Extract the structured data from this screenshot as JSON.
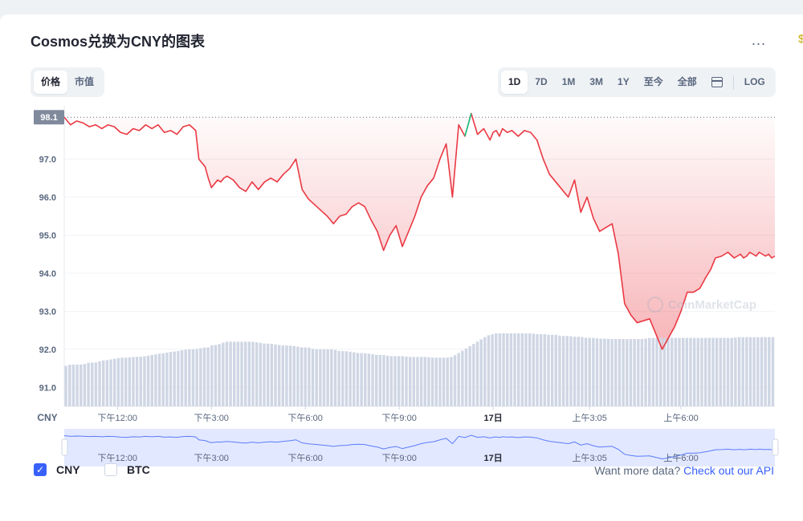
{
  "header": {
    "title": "Cosmos兑换为CNY的图表",
    "more_label": "..."
  },
  "tabs_left": [
    {
      "label": "价格",
      "active": true
    },
    {
      "label": "市值",
      "active": false
    }
  ],
  "tabs_right": [
    {
      "label": "1D",
      "active": true
    },
    {
      "label": "7D",
      "active": false
    },
    {
      "label": "1M",
      "active": false
    },
    {
      "label": "3M",
      "active": false
    },
    {
      "label": "1Y",
      "active": false
    },
    {
      "label": "至今",
      "active": false
    },
    {
      "label": "全部",
      "active": false
    }
  ],
  "log_label": "LOG",
  "calendar_icon": "calendar-icon",
  "watermark_text": "CoinMarketCap",
  "legend": [
    {
      "label": "CNY",
      "checked": true
    },
    {
      "label": "BTC",
      "checked": false
    }
  ],
  "api": {
    "prefix": "Want more data? ",
    "link": "Check out our API"
  },
  "colors": {
    "line_down": "#ea3943",
    "line_up": "#16c784",
    "volume": "#cfd6e4",
    "navigator": "#3861fb",
    "accent": "#3861fb"
  },
  "chart_data": {
    "type": "area",
    "title": "Cosmos兑换为CNY的图表",
    "ylabel": "",
    "xlabel": "",
    "currency_label": "CNY",
    "current_price_label": "98.1",
    "reference_value": 98.1,
    "ylim": [
      90.5,
      98.4
    ],
    "yticks": [
      91.0,
      92.0,
      93.0,
      94.0,
      95.0,
      96.0,
      97.0
    ],
    "ytick_labels": [
      "91.0",
      "92.0",
      "93.0",
      "94.0",
      "95.0",
      "96.0",
      "97.0"
    ],
    "xlim": [
      10.3,
      33.0
    ],
    "xticks": [
      {
        "x": 12.0,
        "label": "下午12:00"
      },
      {
        "x": 15.0,
        "label": "下午3:00"
      },
      {
        "x": 18.0,
        "label": "下午6:00"
      },
      {
        "x": 21.0,
        "label": "下午9:00"
      },
      {
        "x": 24.0,
        "label": "17日"
      },
      {
        "x": 27.08,
        "label": "上午3:05"
      },
      {
        "x": 30.0,
        "label": "上午6:00"
      }
    ],
    "series": [
      {
        "x": [
          10.3,
          10.5,
          10.7,
          10.9,
          11.1,
          11.3,
          11.5,
          11.7,
          11.9,
          12.1,
          12.3,
          12.5,
          12.7,
          12.9,
          13.1,
          13.3,
          13.5,
          13.7,
          13.9,
          14.1,
          14.3,
          14.5,
          14.6,
          14.8,
          14.9,
          15.0,
          15.2,
          15.3,
          15.4,
          15.5,
          15.7,
          15.9,
          16.1,
          16.3,
          16.5,
          16.7,
          16.9,
          17.1,
          17.3,
          17.5,
          17.7,
          17.9,
          18.1,
          18.3,
          18.5,
          18.7,
          18.9,
          19.1,
          19.3,
          19.5,
          19.7,
          19.9,
          20.1,
          20.3,
          20.5,
          20.7,
          20.9,
          21.1,
          21.3,
          21.5,
          21.7,
          21.9,
          22.1,
          22.3,
          22.5,
          22.7,
          22.9,
          23.1,
          23.3,
          23.5,
          23.7,
          23.8,
          23.9,
          24.0,
          24.1,
          24.2,
          24.3,
          24.45,
          24.6,
          24.8,
          25.0,
          25.2,
          25.4,
          25.6,
          25.8,
          26.0,
          26.2,
          26.4,
          26.6,
          26.8,
          27.0,
          27.2,
          27.4,
          27.6,
          27.8,
          28.0,
          28.2,
          28.4,
          28.6,
          28.8,
          29.0,
          29.2,
          29.4,
          29.6,
          29.8,
          30.0,
          30.2,
          30.4,
          30.6,
          30.8,
          30.95,
          31.1,
          31.3,
          31.5,
          31.7,
          31.8,
          31.9,
          32.0,
          32.1,
          32.2,
          32.3,
          32.4,
          32.5,
          32.6,
          32.7,
          32.8,
          32.9,
          33.0
        ],
        "y": [
          98.1,
          97.9,
          98.0,
          97.95,
          97.85,
          97.9,
          97.8,
          97.9,
          97.85,
          97.7,
          97.65,
          97.8,
          97.75,
          97.9,
          97.8,
          97.9,
          97.7,
          97.75,
          97.65,
          97.85,
          97.9,
          97.75,
          97.0,
          96.8,
          96.5,
          96.25,
          96.45,
          96.4,
          96.5,
          96.55,
          96.45,
          96.25,
          96.15,
          96.4,
          96.2,
          96.4,
          96.5,
          96.4,
          96.6,
          96.75,
          97.0,
          96.2,
          95.95,
          95.8,
          95.65,
          95.5,
          95.3,
          95.5,
          95.55,
          95.75,
          95.85,
          95.75,
          95.4,
          95.1,
          94.6,
          95.0,
          95.25,
          94.7,
          95.1,
          95.5,
          96.0,
          96.3,
          96.5,
          97.0,
          97.4,
          96.0,
          97.9,
          97.6,
          98.2,
          97.65,
          97.8,
          97.65,
          97.5,
          97.7,
          97.75,
          97.6,
          97.8,
          97.7,
          97.75,
          97.6,
          97.75,
          97.7,
          97.5,
          97.0,
          96.6,
          96.4,
          96.2,
          96.0,
          96.45,
          95.6,
          96.0,
          95.45,
          95.1,
          95.2,
          95.3,
          94.5,
          93.2,
          92.9,
          92.7,
          92.75,
          92.8,
          92.4,
          92.0,
          92.3,
          92.6,
          93.0,
          93.5,
          93.5,
          93.6,
          93.9,
          94.1,
          94.4,
          94.45,
          94.55,
          94.4,
          94.45,
          94.5,
          94.4,
          94.45,
          94.55,
          94.5,
          94.45,
          94.55,
          94.5,
          94.45,
          94.5,
          94.4,
          94.45
        ],
        "volume_level": [
          91.55,
          91.6,
          91.6,
          91.6,
          91.65,
          91.65,
          91.7,
          91.72,
          91.75,
          91.78,
          91.78,
          91.8,
          91.8,
          91.82,
          91.85,
          91.88,
          91.9,
          91.93,
          91.95,
          91.98,
          92.0,
          92.0,
          92.02,
          92.05,
          92.05,
          92.1,
          92.12,
          92.15,
          92.18,
          92.2,
          92.2,
          92.2,
          92.2,
          92.2,
          92.18,
          92.15,
          92.15,
          92.12,
          92.1,
          92.1,
          92.08,
          92.05,
          92.05,
          92.0,
          92.0,
          92.0,
          92.0,
          91.95,
          91.95,
          91.93,
          91.9,
          91.9,
          91.88,
          91.85,
          91.85,
          91.82,
          91.82,
          91.82,
          91.8,
          91.8,
          91.8,
          91.8,
          91.78,
          91.78,
          91.78,
          91.8,
          91.9,
          92.0,
          92.1,
          92.2,
          92.3,
          92.35,
          92.38,
          92.4,
          92.42,
          92.42,
          92.42,
          92.42,
          92.42,
          92.42,
          92.42,
          92.42,
          92.4,
          92.4,
          92.38,
          92.38,
          92.35,
          92.35,
          92.33,
          92.33,
          92.3,
          92.3,
          92.28,
          92.28,
          92.27,
          92.27,
          92.27,
          92.27,
          92.27,
          92.27,
          92.3,
          92.3,
          92.3,
          92.3,
          92.3,
          92.3,
          92.3,
          92.3,
          92.3,
          92.3,
          92.3,
          92.3,
          92.3,
          92.3,
          92.3,
          92.32,
          92.32,
          92.32,
          92.32,
          92.32,
          92.32,
          92.32,
          92.32,
          92.32,
          92.32,
          92.32,
          92.32,
          92.32
        ]
      }
    ]
  }
}
